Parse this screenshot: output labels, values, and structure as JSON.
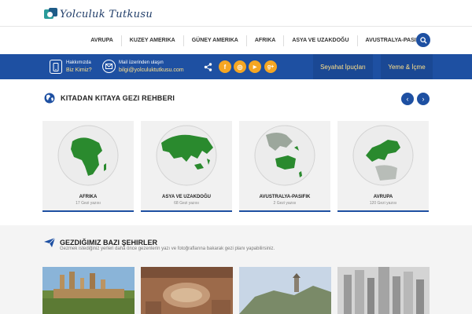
{
  "header": {
    "logo_text": "Yolculuk Tutkusu"
  },
  "nav": {
    "items": [
      "AVRUPA",
      "KUZEY AMERIKA",
      "GÜNEY AMERIKA",
      "AFRIKA",
      "ASYA VE UZAKDOĞU",
      "AVUSTRALYA-PASIFIK"
    ],
    "search_icon": "search-icon"
  },
  "infobar": {
    "about_small": "Hakkımızda",
    "about_link": "Biz Kimiz?",
    "mail_small": "Mail üzerinden ulaşın",
    "mail_link": "bilgi@yolculuktutkusu.com",
    "social": [
      {
        "name": "facebook",
        "glyph": "f",
        "color": "#f5a623"
      },
      {
        "name": "instagram",
        "glyph": "◎",
        "color": "#f5a623"
      },
      {
        "name": "youtube",
        "glyph": "▶",
        "color": "#f5a623"
      },
      {
        "name": "google-plus",
        "glyph": "g+",
        "color": "#f5a623"
      }
    ],
    "tabs": [
      "Seyahat İpuçları",
      "Yeme & İçme"
    ]
  },
  "continents": {
    "title": "KITADAN KITAYA GEZI REHBERI",
    "prev": "‹",
    "next": "›",
    "cards": [
      {
        "name": "AFRIKA",
        "count": "17 Gezi yazısı"
      },
      {
        "name": "ASYA VE UZAKDOĞU",
        "count": "68 Gezi yazısı"
      },
      {
        "name": "AVUSTRALYA-PASIFIK",
        "count": "2 Gezi yazısı"
      },
      {
        "name": "AVRUPA",
        "count": "120 Gezi yazısı"
      }
    ]
  },
  "cities": {
    "title": "GEZDIĞIMIZ BAZI ŞEHIRLER",
    "subtitle": "Gezmek istediğiniz yerleri daha önce gezenlerin yazı ve fotoğraflarına bakarak gezi planı yapabilirsiniz."
  },
  "colors": {
    "brand": "#1e50a2",
    "accent": "#ffe08a",
    "land": "#2a8a2e",
    "social": "#f5a623"
  }
}
